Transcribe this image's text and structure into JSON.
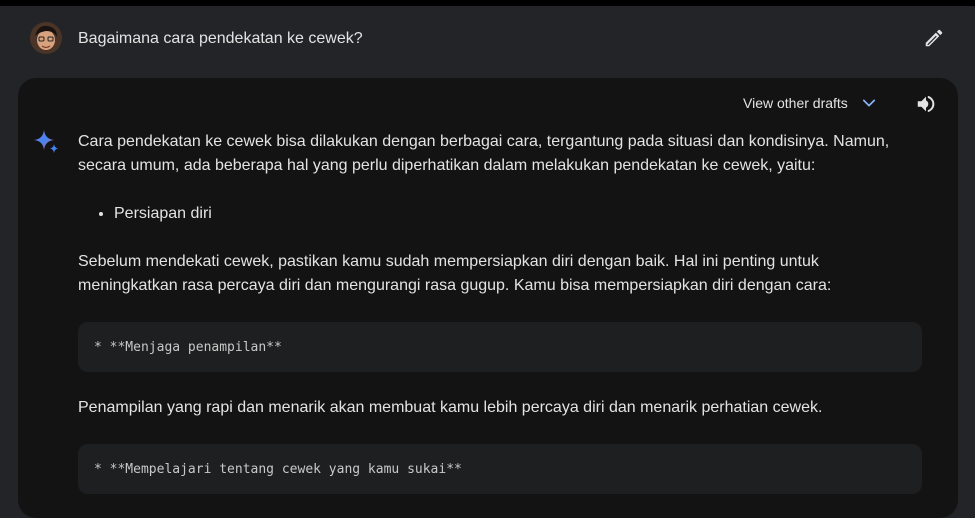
{
  "user": {
    "avatar_icon": "user-avatar",
    "prompt": "Bagaimana cara pendekatan ke cewek?",
    "edit_icon": "pencil-icon"
  },
  "response": {
    "drafts_label": "View other drafts",
    "drafts_icon": "chevron-down-icon",
    "speaker_icon": "speaker-icon",
    "sparkle_icon": "sparkle-icon",
    "accent_color": "#8ab4f8",
    "paragraph_1": "Cara pendekatan ke cewek bisa dilakukan dengan berbagai cara, tergantung pada situasi dan kondisinya. Namun, secara umum, ada beberapa hal yang perlu diperhatikan dalam melakukan pendekatan ke cewek, yaitu:",
    "bullets": [
      "Persiapan diri"
    ],
    "paragraph_2": "Sebelum mendekati cewek, pastikan kamu sudah mempersiapkan diri dengan baik. Hal ini penting untuk meningkatkan rasa percaya diri dan mengurangi rasa gugup. Kamu bisa mempersiapkan diri dengan cara:",
    "code_1": "* **Menjaga penampilan**",
    "paragraph_3": "Penampilan yang rapi dan menarik akan membuat kamu lebih percaya diri dan menarik perhatian cewek.",
    "code_2": "* **Mempelajari tentang cewek yang kamu sukai**"
  }
}
